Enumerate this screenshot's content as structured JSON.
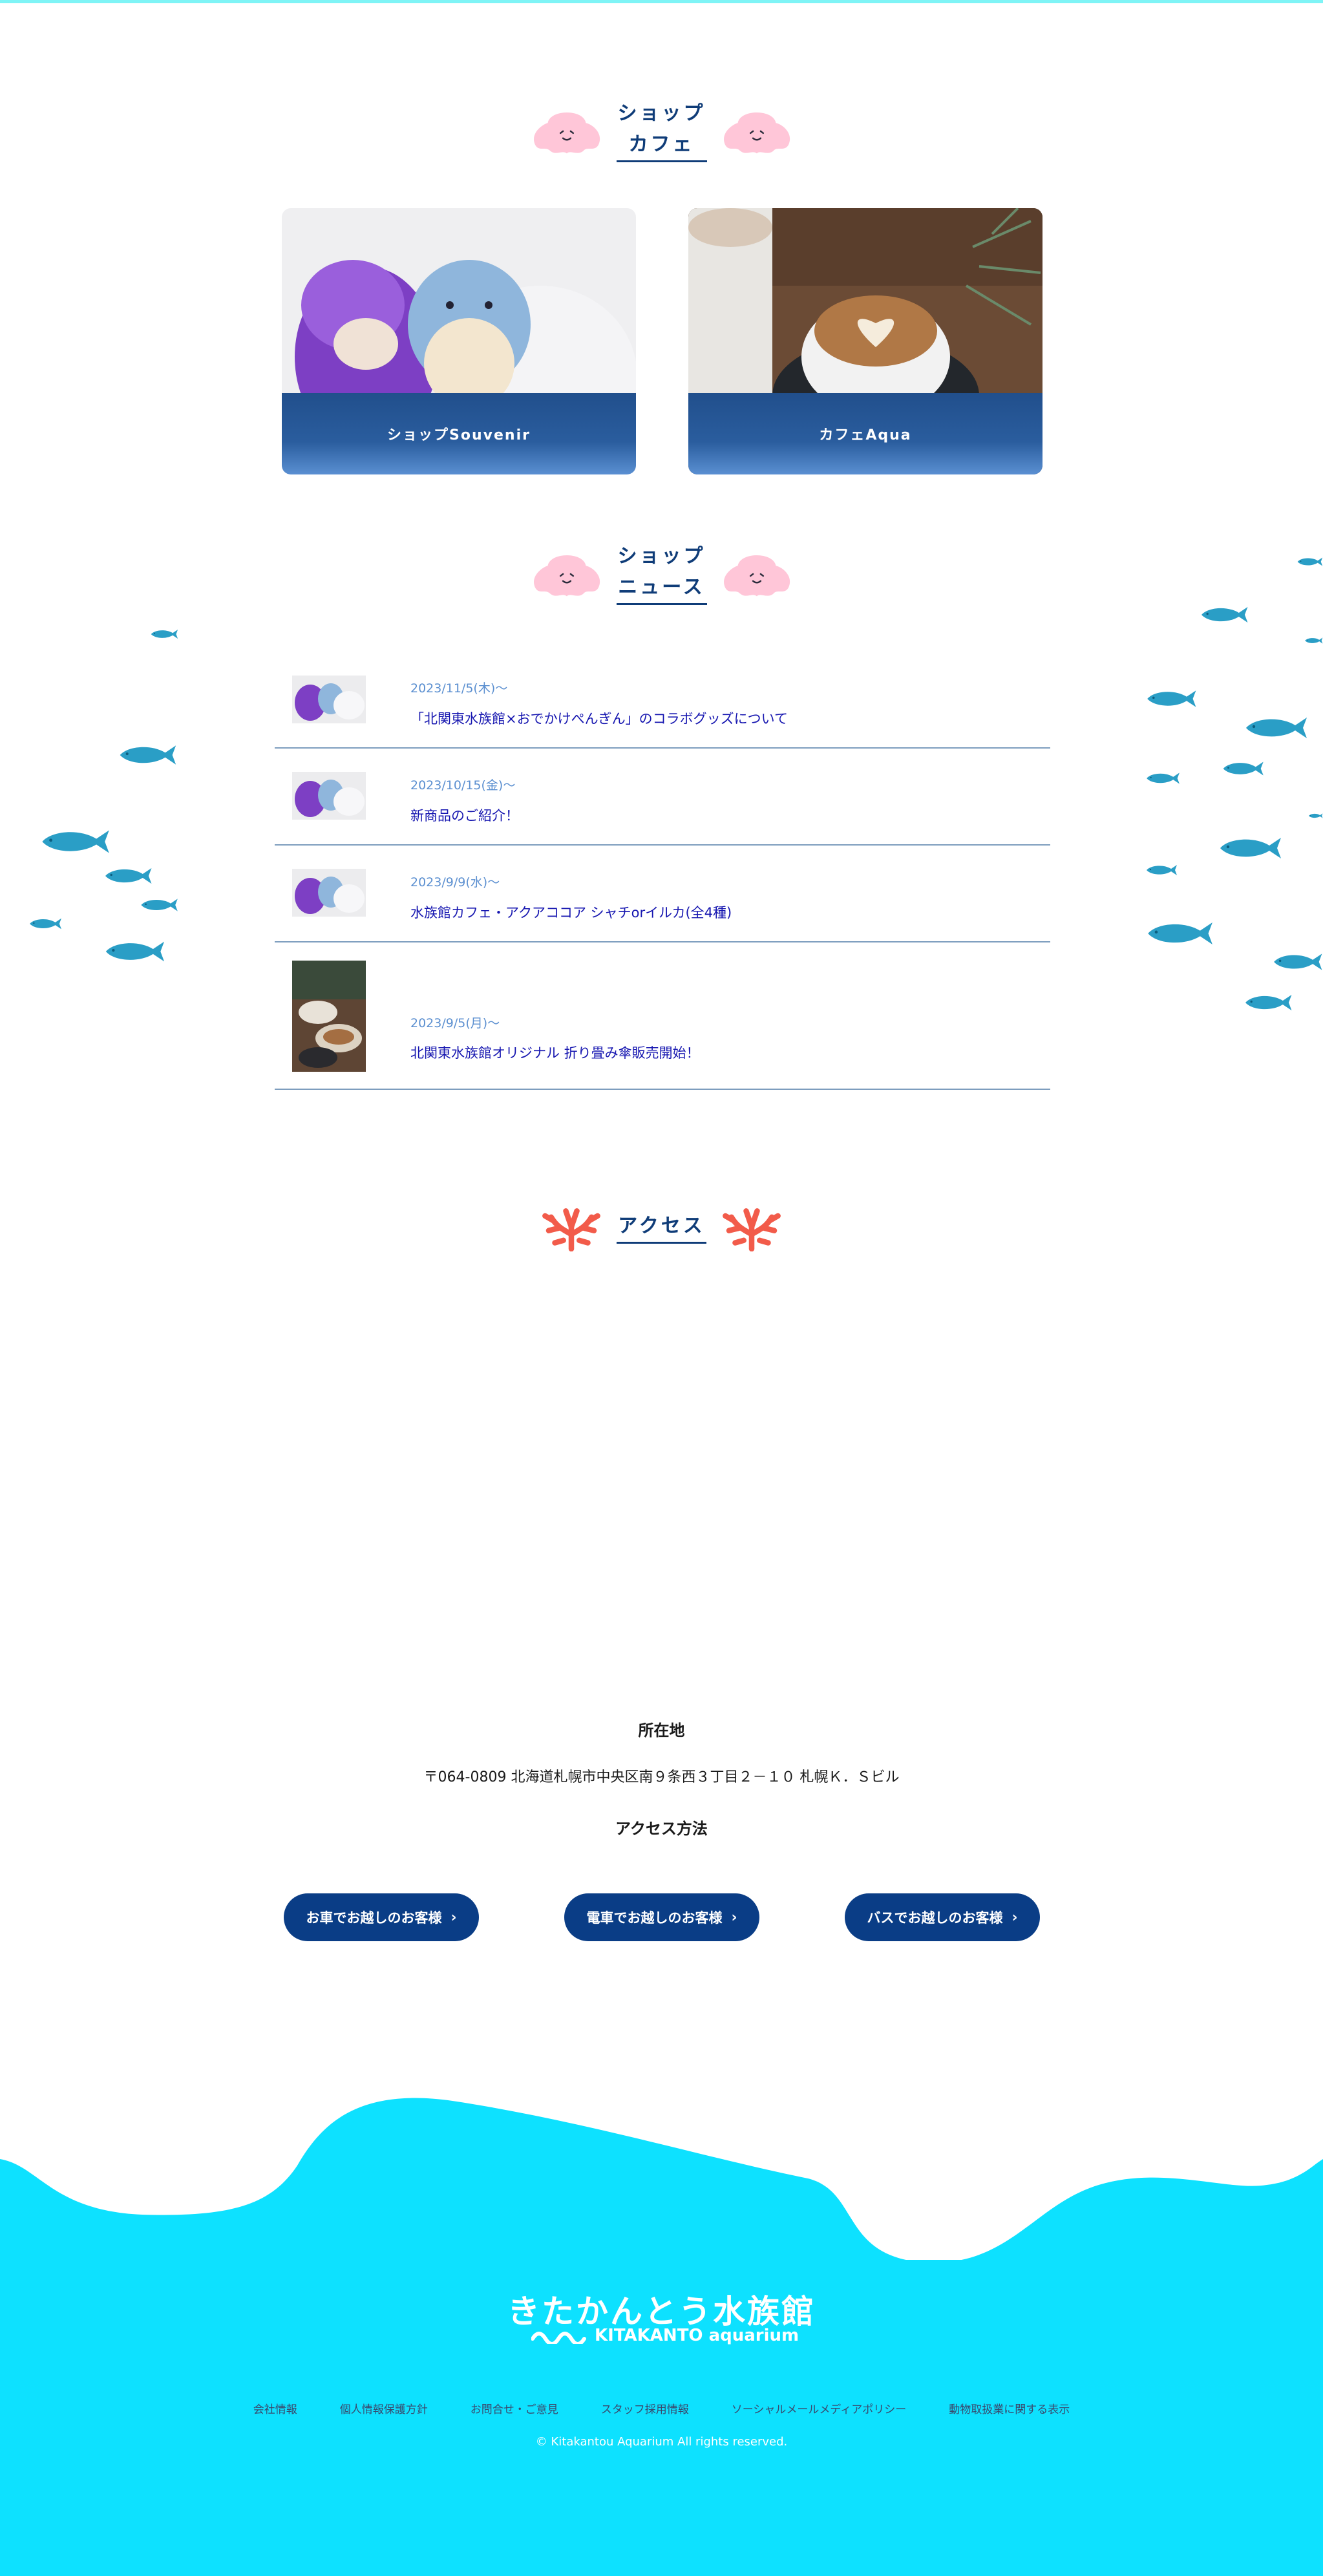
{
  "colors": {
    "navy": "#0f3c78",
    "button": "#0a3d86",
    "footer": "#0de1ff",
    "fish": "#2a9ec6",
    "coral": "#f25b4a",
    "blob": "#ffc6d8"
  },
  "sections": {
    "shop_cafe": {
      "line1": "ショップ",
      "line2": "カフェ",
      "icon": "blob-icon"
    },
    "shop_news": {
      "line1": "ショップ",
      "line2": "ニュース",
      "icon": "blob-icon"
    },
    "access": {
      "title": "アクセス",
      "icon": "coral-icon"
    }
  },
  "cards": [
    {
      "label": "ショップSouvenir",
      "image": "plush-toys-photo"
    },
    {
      "label": "カフェAqua",
      "image": "latte-photo"
    }
  ],
  "news": [
    {
      "date": "2023/11/5(木)〜",
      "text": "「北関東水族館×おでかけぺんぎん」のコラボグッズについて"
    },
    {
      "date": "2023/10/15(金)〜",
      "text": "新商品のご紹介！"
    },
    {
      "date": "2023/9/9(水)〜",
      "text": "水族館カフェ・アクアココア シャチorイルカ(全4種)"
    },
    {
      "date": "2023/9/5(月)〜",
      "text": "北関東水族館オリジナル 折り畳み傘販売開始！"
    }
  ],
  "access_info": {
    "location_heading": "所在地",
    "address": "〒064-0809 北海道札幌市中央区南９条西３丁目２－１０ 札幌Ｋ．Ｓビル",
    "method_heading": "アクセス方法",
    "buttons": [
      "お車でお越しのお客様",
      "電車でお越しのお客様",
      "バスでお越しのお客様"
    ],
    "chevron_icon": "chevron-right-icon"
  },
  "footer": {
    "logo_jp": "きたかんとう水族館",
    "logo_en": "KITAKANTO aquarium",
    "links": [
      "会社情報",
      "個人情報保護方針",
      "お問合せ・ご意見",
      "スタッフ採用情報",
      "ソーシャルメールメディアポリシー",
      "動物取扱業に関する表示"
    ],
    "copyright": "© Kitakantou Aquarium All rights reserved."
  }
}
